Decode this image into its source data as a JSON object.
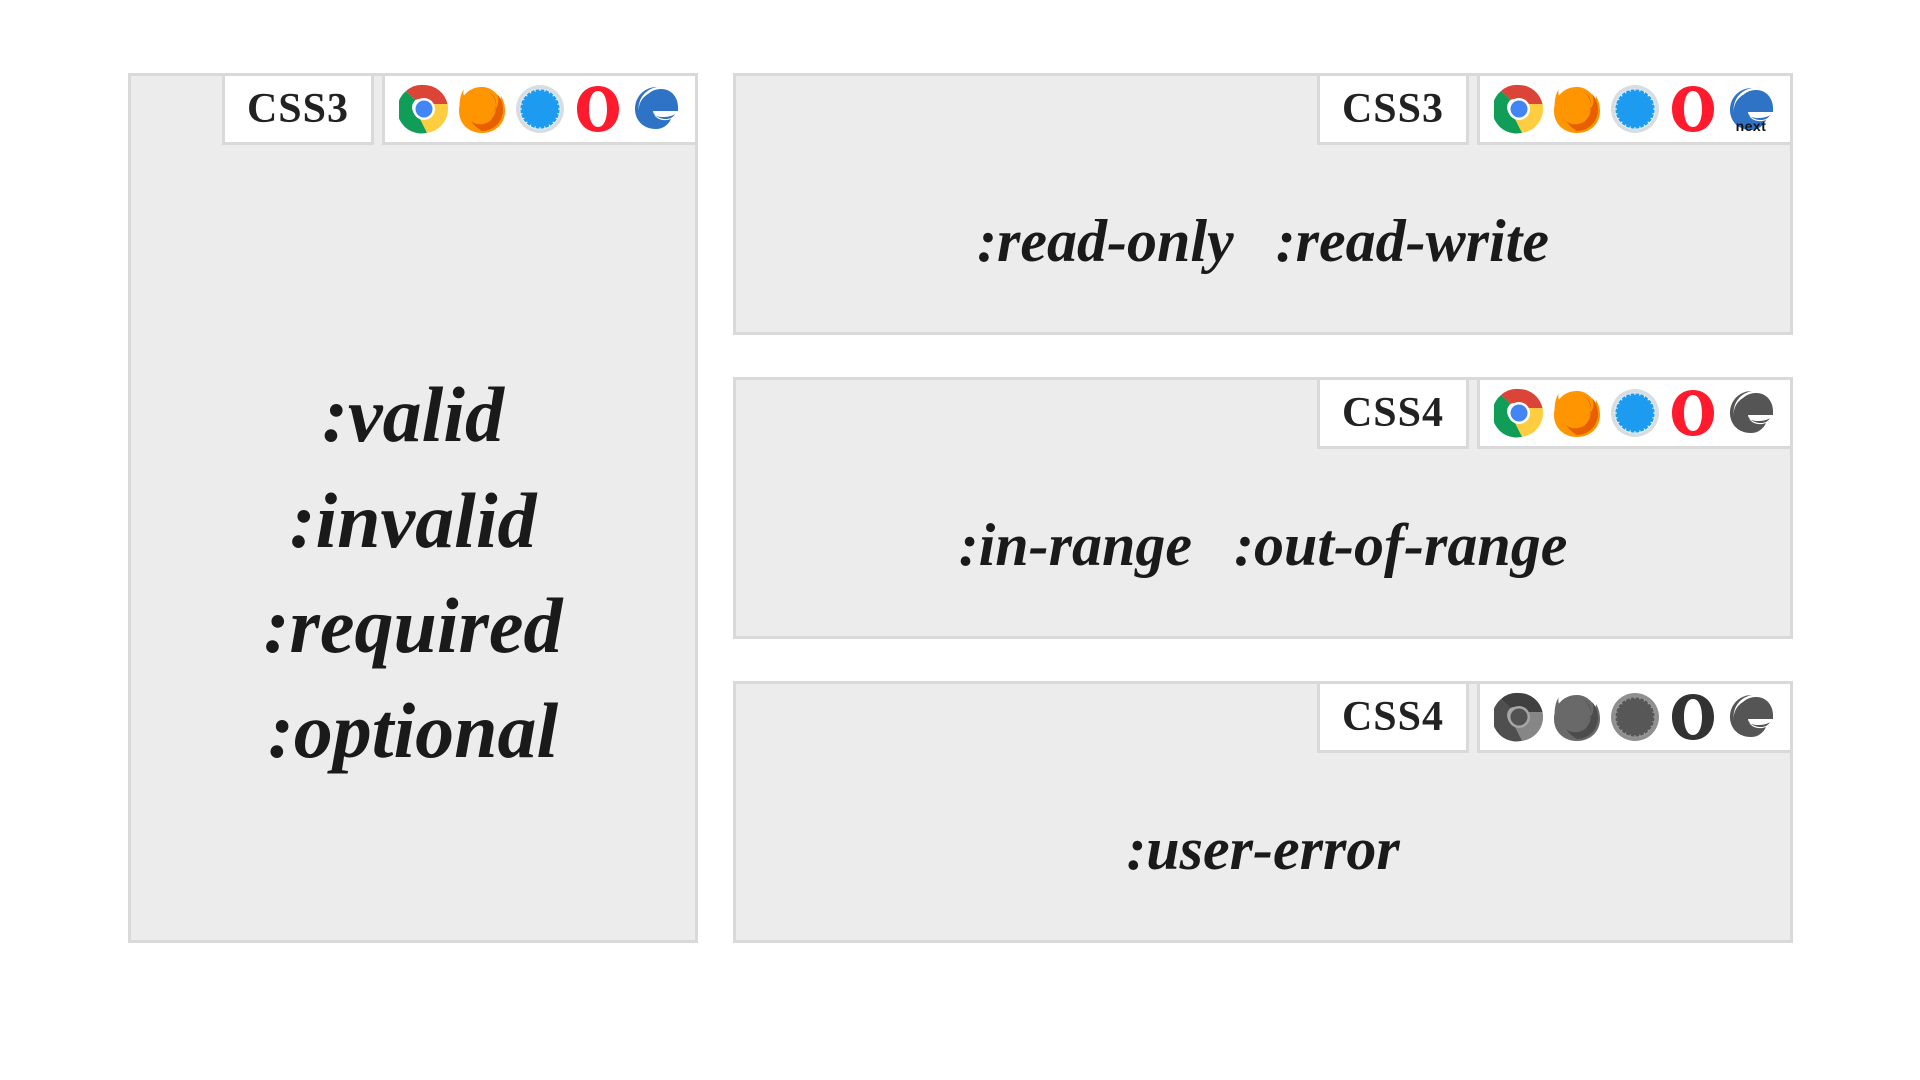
{
  "cards": {
    "left": {
      "spec": "CSS3",
      "browsers": [
        {
          "name": "chrome",
          "supported": true
        },
        {
          "name": "firefox",
          "supported": true
        },
        {
          "name": "safari",
          "supported": true
        },
        {
          "name": "opera",
          "supported": true
        },
        {
          "name": "edge",
          "supported": true
        }
      ],
      "edge_variant": "standard",
      "selectors": [
        ":valid",
        ":invalid",
        ":required",
        ":optional"
      ]
    },
    "r1": {
      "spec": "CSS3",
      "browsers": [
        {
          "name": "chrome",
          "supported": true
        },
        {
          "name": "firefox",
          "supported": true
        },
        {
          "name": "safari",
          "supported": true
        },
        {
          "name": "opera",
          "supported": true
        },
        {
          "name": "edge",
          "supported": true
        }
      ],
      "edge_variant": "next",
      "selectors": [
        ":read-only",
        ":read-write"
      ]
    },
    "r2": {
      "spec": "CSS4",
      "browsers": [
        {
          "name": "chrome",
          "supported": true
        },
        {
          "name": "firefox",
          "supported": true
        },
        {
          "name": "safari",
          "supported": true
        },
        {
          "name": "opera",
          "supported": true
        },
        {
          "name": "edge",
          "supported": false
        }
      ],
      "edge_variant": "standard",
      "selectors": [
        ":in-range",
        ":out-of-range"
      ]
    },
    "r3": {
      "spec": "CSS4",
      "browsers": [
        {
          "name": "chrome",
          "supported": false
        },
        {
          "name": "firefox",
          "supported": false
        },
        {
          "name": "safari",
          "supported": false
        },
        {
          "name": "opera",
          "supported": false
        },
        {
          "name": "edge",
          "supported": false
        }
      ],
      "edge_variant": "standard",
      "selectors": [
        ":user-error"
      ]
    }
  },
  "edge_next_label": "next"
}
